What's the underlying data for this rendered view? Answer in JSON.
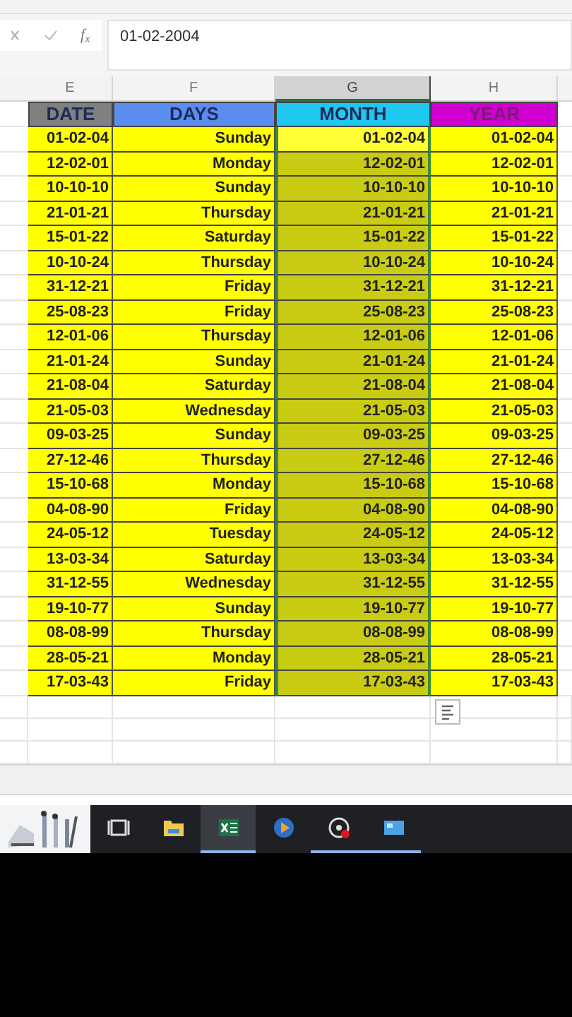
{
  "formula_bar": {
    "fx": "f$_{x}$",
    "value": "01-02-2004"
  },
  "columns": [
    {
      "letter": "E",
      "selected": false
    },
    {
      "letter": "F",
      "selected": false
    },
    {
      "letter": "G",
      "selected": true
    },
    {
      "letter": "H",
      "selected": false
    }
  ],
  "headers": [
    {
      "label": "DATE",
      "color": "#808080"
    },
    {
      "label": "DAYS",
      "color": "#5b8def"
    },
    {
      "label": "MONTH",
      "color": "#1ec8f0"
    },
    {
      "label": "YEAR",
      "color": "#d000d0"
    }
  ],
  "rows": [
    {
      "active": true,
      "cells": [
        "01-02-04",
        "Sunday",
        "01-02-04",
        "01-02-04"
      ]
    },
    {
      "active": false,
      "cells": [
        "12-02-01",
        "Monday",
        "12-02-01",
        "12-02-01"
      ]
    },
    {
      "active": false,
      "cells": [
        "10-10-10",
        "Sunday",
        "10-10-10",
        "10-10-10"
      ]
    },
    {
      "active": false,
      "cells": [
        "21-01-21",
        "Thursday",
        "21-01-21",
        "21-01-21"
      ]
    },
    {
      "active": false,
      "cells": [
        "15-01-22",
        "Saturday",
        "15-01-22",
        "15-01-22"
      ]
    },
    {
      "active": false,
      "cells": [
        "10-10-24",
        "Thursday",
        "10-10-24",
        "10-10-24"
      ]
    },
    {
      "active": false,
      "cells": [
        "31-12-21",
        "Friday",
        "31-12-21",
        "31-12-21"
      ]
    },
    {
      "active": false,
      "cells": [
        "25-08-23",
        "Friday",
        "25-08-23",
        "25-08-23"
      ]
    },
    {
      "active": false,
      "cells": [
        "12-01-06",
        "Thursday",
        "12-01-06",
        "12-01-06"
      ]
    },
    {
      "active": false,
      "cells": [
        "21-01-24",
        "Sunday",
        "21-01-24",
        "21-01-24"
      ]
    },
    {
      "active": false,
      "cells": [
        "21-08-04",
        "Saturday",
        "21-08-04",
        "21-08-04"
      ]
    },
    {
      "active": false,
      "cells": [
        "21-05-03",
        "Wednesday",
        "21-05-03",
        "21-05-03"
      ]
    },
    {
      "active": false,
      "cells": [
        "09-03-25",
        "Sunday",
        "09-03-25",
        "09-03-25"
      ]
    },
    {
      "active": false,
      "cells": [
        "27-12-46",
        "Thursday",
        "27-12-46",
        "27-12-46"
      ]
    },
    {
      "active": false,
      "cells": [
        "15-10-68",
        "Monday",
        "15-10-68",
        "15-10-68"
      ]
    },
    {
      "active": false,
      "cells": [
        "04-08-90",
        "Friday",
        "04-08-90",
        "04-08-90"
      ]
    },
    {
      "active": false,
      "cells": [
        "24-05-12",
        "Tuesday",
        "24-05-12",
        "24-05-12"
      ]
    },
    {
      "active": false,
      "cells": [
        "13-03-34",
        "Saturday",
        "13-03-34",
        "13-03-34"
      ]
    },
    {
      "active": false,
      "cells": [
        "31-12-55",
        "Wednesday",
        "31-12-55",
        "31-12-55"
      ]
    },
    {
      "active": false,
      "cells": [
        "19-10-77",
        "Sunday",
        "19-10-77",
        "19-10-77"
      ]
    },
    {
      "active": false,
      "cells": [
        "08-08-99",
        "Thursday",
        "08-08-99",
        "08-08-99"
      ]
    },
    {
      "active": false,
      "cells": [
        "28-05-21",
        "Monday",
        "28-05-21",
        "28-05-21"
      ]
    },
    {
      "active": false,
      "cells": [
        "17-03-43",
        "Friday",
        "17-03-43",
        "17-03-43"
      ]
    }
  ],
  "taskbar": [
    {
      "kind": "taskview",
      "selected": false,
      "running": false
    },
    {
      "kind": "folder",
      "selected": false,
      "running": false
    },
    {
      "kind": "excel",
      "selected": true,
      "running": true
    },
    {
      "kind": "media",
      "selected": false,
      "running": false
    },
    {
      "kind": "recorder",
      "selected": false,
      "running": true
    },
    {
      "kind": "window",
      "selected": false,
      "running": true
    }
  ]
}
